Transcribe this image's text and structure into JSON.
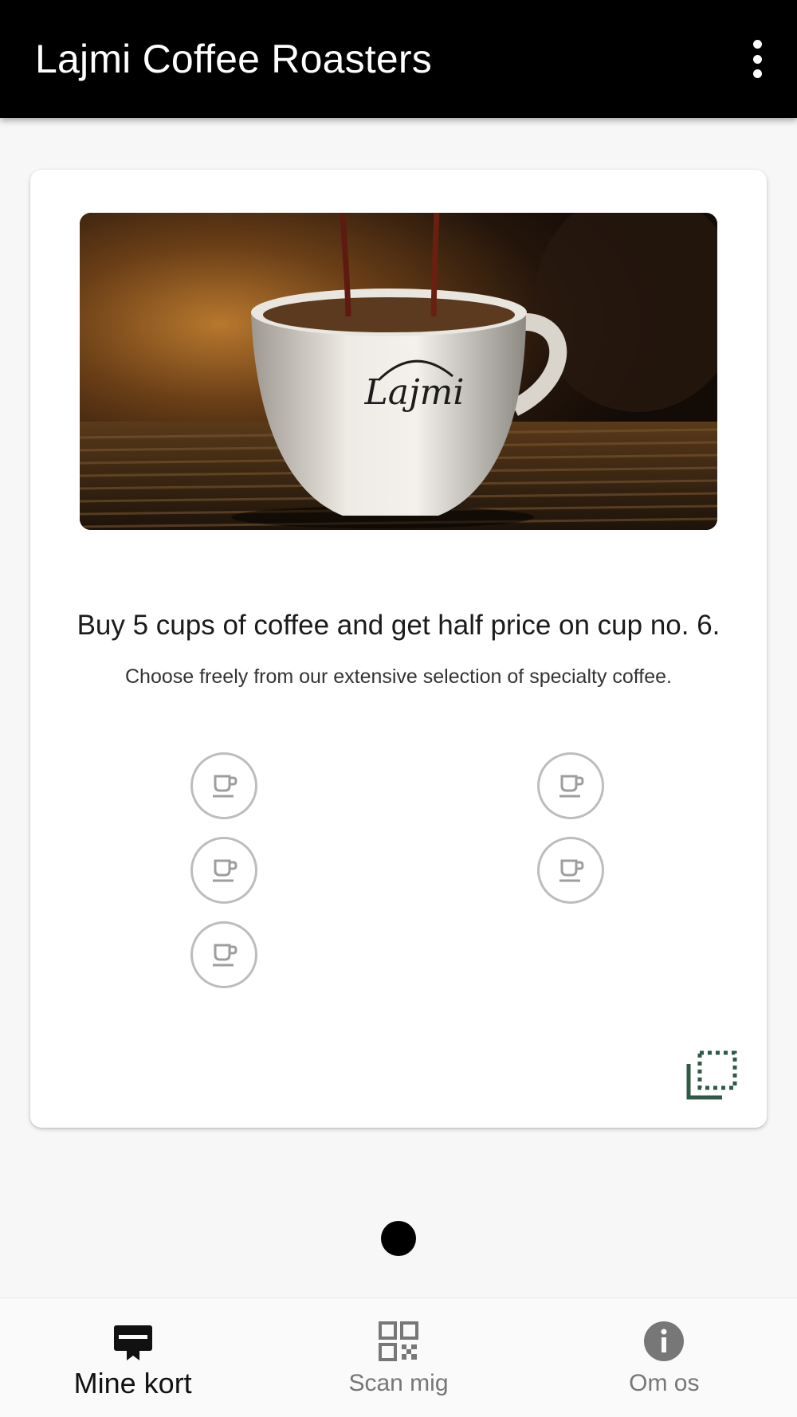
{
  "app_bar": {
    "title": "Lajmi Coffee Roasters",
    "menu_icon": "more-vert-icon"
  },
  "card": {
    "image_alt": "Espresso pouring into a Lajmi cup",
    "cup_logo_text": "Lajmi",
    "title": "Buy 5 cups of coffee and get half price on cup no. 6.",
    "subtitle": "Choose freely from our extensive selection of specialty coffee.",
    "stamps_total": 5,
    "stamps_filled": 0,
    "stamp_icon": "coffee-cup-icon",
    "flip_icon": "flip-card-icon",
    "accent_color": "#2e5a46"
  },
  "pager": {
    "count": 1,
    "active": 0
  },
  "bottom_nav": {
    "items": [
      {
        "label": "Mine kort",
        "icon": "card-icon",
        "active": true
      },
      {
        "label": "Scan mig",
        "icon": "qr-code-icon",
        "active": false
      },
      {
        "label": "Om os",
        "icon": "info-icon",
        "active": false
      }
    ]
  }
}
